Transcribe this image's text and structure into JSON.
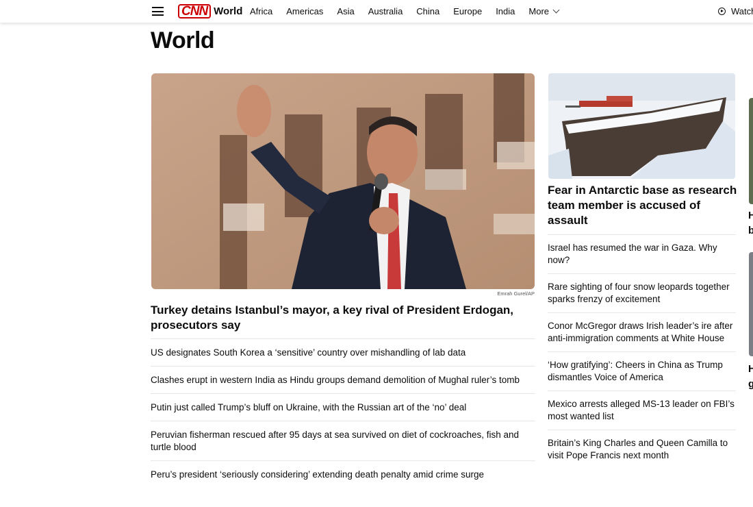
{
  "header": {
    "logo_brand": "CNN",
    "logo_section": "World",
    "nav": [
      "Africa",
      "Americas",
      "Asia",
      "Australia",
      "China",
      "Europe",
      "India"
    ],
    "more_label": "More",
    "watch_label": "Watch"
  },
  "page_title": "World",
  "hero": {
    "image_alt": "Man in dark suit speaking into microphone and waving",
    "credit": "Emrah Gurel/AP",
    "headline": "Turkey detains Istanbul’s mayor, a key rival of President Erdogan, prosecutors say"
  },
  "left_list": [
    "US designates South Korea a ‘sensitive’ country over mishandling of lab data",
    "Clashes erupt in western India as Hindu groups demand demolition of Mughal ruler’s tomb",
    "Putin just called Trump’s bluff on Ukraine, with the Russian art of the ‘no’ deal",
    "Peruvian fisherman rescued after 95 days at sea survived on diet of cockroaches, fish and turtle blood",
    "Peru’s president ‘seriously considering’ extending death penalty amid crime surge"
  ],
  "right": {
    "image_alt": "Research base on snowy Antarctic cliff",
    "headline": "Fear in Antarctic base as research team member is accused of assault",
    "list": [
      "Israel has resumed the war in Gaza. Why now?",
      "Rare sighting of four snow leopards together sparks frenzy of excitement",
      "Conor McGregor draws Irish leader’s ire after anti-immigration comments at White House",
      "‘How gratifying’: Cheers in China as Trump dismantles Voice of America",
      "Mexico arrests alleged MS-13 leader on FBI’s most wanted list",
      "Britain’s King Charles and Queen Camilla to visit Pope Francis next month"
    ]
  },
  "far_right": {
    "text_1a": "H",
    "text_1b": "b",
    "text_2a": "H",
    "text_2b": "g"
  },
  "colors": {
    "brand": "#cc0000",
    "text": "#0c0c0c",
    "divider": "#e6e6e6"
  }
}
